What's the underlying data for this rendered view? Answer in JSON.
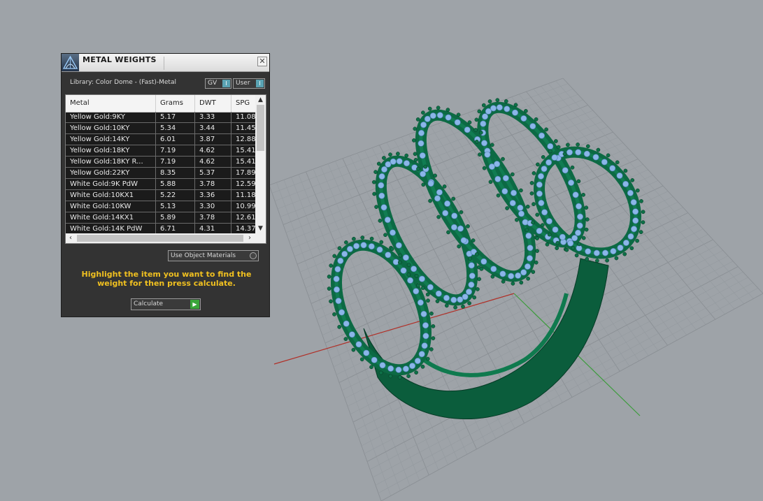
{
  "panel": {
    "title": "METAL WEIGHTS",
    "close": "✕",
    "library": "Library: Color Dome - (Fast)-Metal",
    "gv_label": "GV",
    "user_label": "User",
    "toggle_glyph": "I",
    "columns": [
      "Metal",
      "Grams",
      "DWT",
      "SPG"
    ],
    "rows": [
      [
        "Yellow Gold:9KY",
        "5.17",
        "3.33",
        "11.08"
      ],
      [
        "Yellow Gold:10KY",
        "5.34",
        "3.44",
        "11.45"
      ],
      [
        "Yellow Gold:14KY",
        "6.01",
        "3.87",
        "12.88"
      ],
      [
        "Yellow Gold:18KY",
        "7.19",
        "4.62",
        "15.41"
      ],
      [
        "Yellow Gold:18KY R...",
        "7.19",
        "4.62",
        "15.41"
      ],
      [
        "Yellow Gold:22KY",
        "8.35",
        "5.37",
        "17.89"
      ],
      [
        "White Gold:9K PdW",
        "5.88",
        "3.78",
        "12.59"
      ],
      [
        "White Gold:10KX1",
        "5.22",
        "3.36",
        "11.18"
      ],
      [
        "White Gold:10KW",
        "5.13",
        "3.30",
        "10.99"
      ],
      [
        "White Gold:14KX1",
        "5.89",
        "3.78",
        "12.61"
      ],
      [
        "White Gold:14K PdW",
        "6.71",
        "4.31",
        "14.37"
      ]
    ],
    "use_object_materials": "Use Object Materials",
    "hint": "Highlight the item you want to find the weight for then press calculate.",
    "calculate": "Calculate"
  },
  "colors": {
    "viewport_bg": "#9ea3a8",
    "panel_bg": "#333333",
    "hint_text": "#f0c020",
    "ring_green": "#0c6a44",
    "stone_blue": "#8ab6e8",
    "x_axis": "#b03028",
    "y_axis": "#3c9c3c"
  },
  "icons": {
    "logo": "dome-logo-icon",
    "close": "close-icon",
    "scroll_up": "scroll-up-icon",
    "scroll_down": "scroll-down-icon",
    "scroll_left": "scroll-left-icon",
    "scroll_right": "scroll-right-icon",
    "go": "play-icon"
  }
}
